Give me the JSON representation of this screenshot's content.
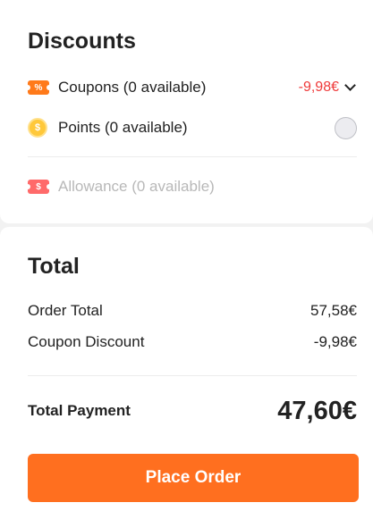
{
  "discounts": {
    "title": "Discounts",
    "coupons": {
      "icon": "%",
      "label": "Coupons (0 available)",
      "value": "-9,98€"
    },
    "points": {
      "icon": "$",
      "label": "Points (0 available)"
    },
    "allowance": {
      "icon": "$",
      "label": "Allowance (0 available)"
    }
  },
  "total": {
    "title": "Total",
    "order_total_label": "Order Total",
    "order_total_value": "57,58€",
    "coupon_discount_label": "Coupon Discount",
    "coupon_discount_value": "-9,98€",
    "payment_label": "Total Payment",
    "payment_value": "47,60€",
    "place_order_label": "Place Order"
  },
  "colors": {
    "accent": "#ff6f1f",
    "discount_red": "#ef3a3a",
    "coupon_icon": "#ff7a1a",
    "allowance_icon": "#ff6a6a",
    "coin": "#ffc83a"
  }
}
